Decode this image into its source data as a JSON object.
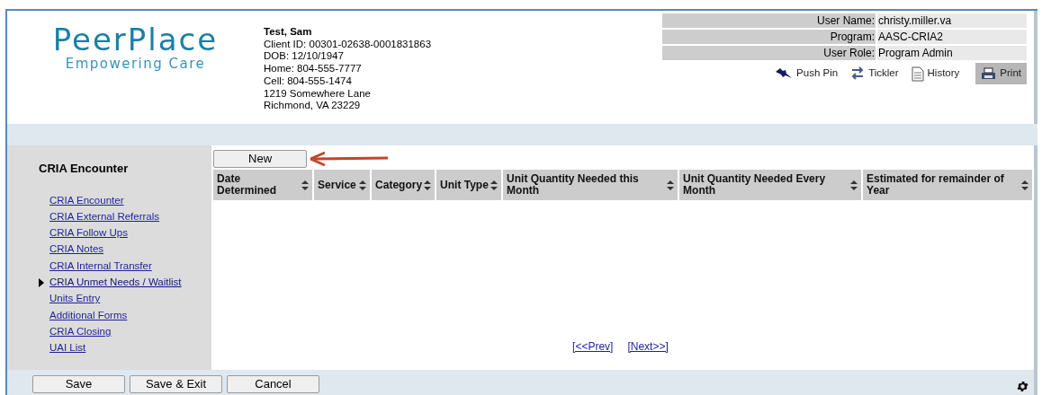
{
  "logo": {
    "name": "PeerPlace",
    "tagline": "Empowering Care"
  },
  "client": {
    "name": "Test, Sam",
    "lines": [
      "Client ID: 00301-02638-0001831863",
      "DOB: 12/10/1947",
      "Home: 804-555-7777",
      "Cell: 804-555-1474",
      "1219 Somewhere Lane",
      "Richmond, VA 23229"
    ]
  },
  "user_info": [
    {
      "label": "User Name:",
      "value": "christy.miller.va"
    },
    {
      "label": "Program:",
      "value": "AASC-CRIA2"
    },
    {
      "label": "User Role:",
      "value": "Program Admin"
    }
  ],
  "toolbar": [
    {
      "kind": "pin",
      "label": "Push Pin",
      "highlighted": false
    },
    {
      "kind": "tickler",
      "label": "Tickler",
      "highlighted": false
    },
    {
      "kind": "history",
      "label": "History",
      "highlighted": false
    },
    {
      "kind": "print",
      "label": "Print",
      "highlighted": true
    }
  ],
  "sidebar": {
    "title": "CRIA Encounter",
    "items": [
      {
        "label": "CRIA Encounter",
        "selected": false
      },
      {
        "label": "CRIA External Referrals",
        "selected": false
      },
      {
        "label": "CRIA Follow Ups",
        "selected": false
      },
      {
        "label": "CRIA Notes",
        "selected": false
      },
      {
        "label": "CRIA Internal Transfer",
        "selected": false
      },
      {
        "label": "CRIA Unmet Needs / Waitlist",
        "selected": true
      },
      {
        "label": "Units Entry",
        "selected": false
      },
      {
        "label": "Additional Forms",
        "selected": false
      },
      {
        "label": "CRIA Closing",
        "selected": false
      },
      {
        "label": "UAI List",
        "selected": false
      }
    ]
  },
  "new_button": "New",
  "table": {
    "columns": [
      "Date Determined",
      "Service",
      "Category",
      "Unit Type",
      "Unit Quantity Needed this Month",
      "Unit Quantity Needed Every Month",
      "Estimated for remainder of Year"
    ]
  },
  "pagination": {
    "prev": "[<<Prev]",
    "next": "[Next>>]"
  },
  "footer_buttons": [
    "Save",
    "Save & Exit",
    "Cancel"
  ]
}
